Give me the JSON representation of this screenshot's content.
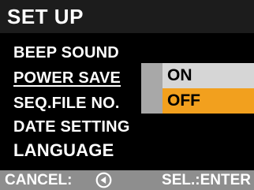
{
  "header": {
    "title": "SET UP"
  },
  "menu": {
    "items": [
      {
        "label": "BEEP SOUND"
      },
      {
        "label": "POWER SAVE"
      },
      {
        "label": "SEQ.FILE NO."
      },
      {
        "label": "DATE SETTING"
      },
      {
        "label": "LANGUAGE"
      }
    ],
    "selected": "POWER SAVE"
  },
  "submenu": {
    "options": [
      {
        "label": "ON"
      },
      {
        "label": "OFF"
      }
    ],
    "selected": "OFF"
  },
  "footer": {
    "cancel_label": "CANCEL:",
    "cancel_icon": "left-arrow-circle-icon",
    "select_label": "SEL.:ENTER"
  },
  "colors": {
    "background": "#000000",
    "header": "#1c1c1c",
    "highlight": "#f2a01e",
    "option_bg": "#d6d6d6",
    "footer": "#8e8e8e"
  }
}
